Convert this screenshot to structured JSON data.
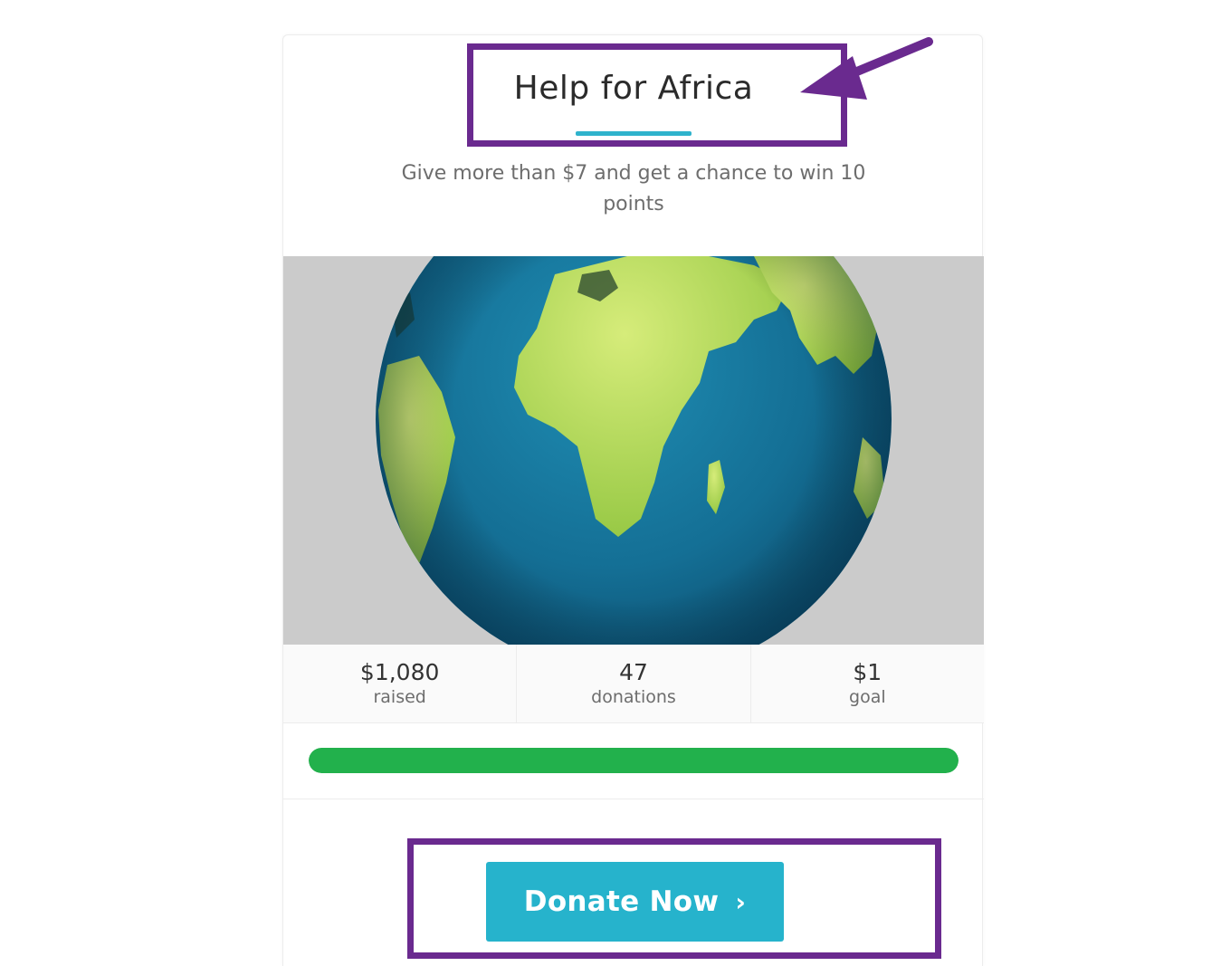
{
  "campaign": {
    "title": "Help for Africa",
    "subtitle": "Give more than $7 and get a chance to win 10 points",
    "image_alt": "globe-icon"
  },
  "stats": [
    {
      "value": "$1,080",
      "label": "raised"
    },
    {
      "value": "47",
      "label": "donations"
    },
    {
      "value": "$1",
      "label": "goal"
    }
  ],
  "progress": {
    "percent": 100,
    "color": "#22b14c"
  },
  "button": {
    "label": "Donate Now",
    "icon": "chevron-right-icon",
    "color": "#26b3cc"
  },
  "annotations": {
    "color": "#6a2a8f"
  }
}
